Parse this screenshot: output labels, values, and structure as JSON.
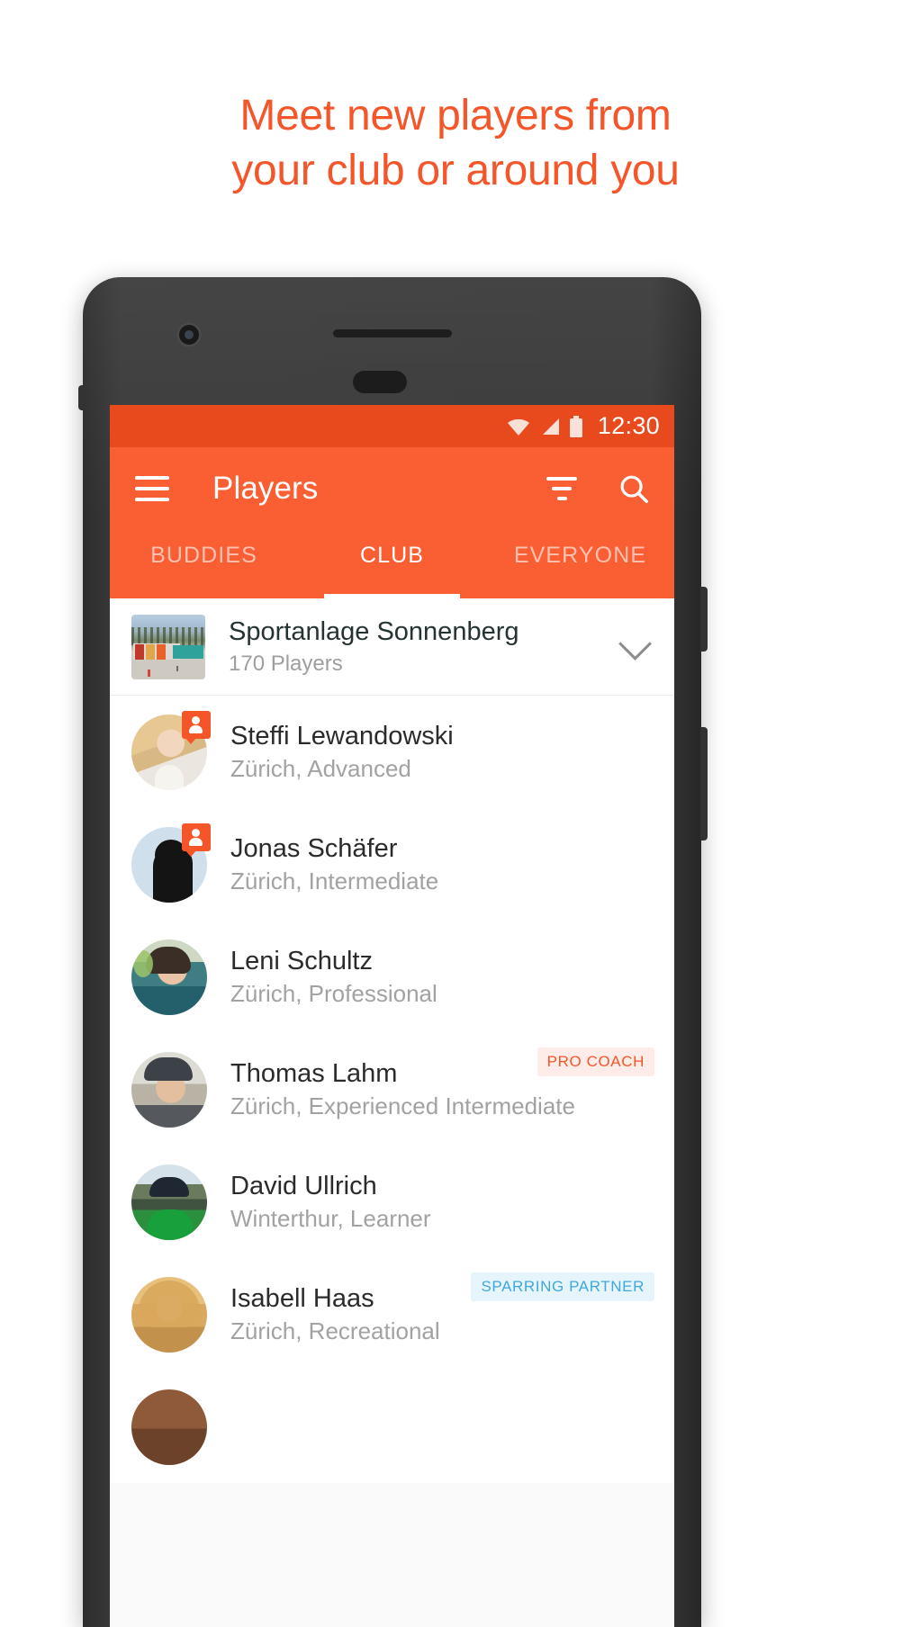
{
  "headline": {
    "line1": "Meet new players from",
    "line2": "your club or around you",
    "color": "#f4562a"
  },
  "phone": {
    "statusbar": {
      "clock": "12:30",
      "icons": [
        "wifi-icon",
        "signal-icon",
        "battery-icon"
      ],
      "background": "#e8491d"
    },
    "appbar": {
      "menu_icon": "hamburger-menu-icon",
      "title": "Players",
      "filter_icon": "filter-icon",
      "search_icon": "search-icon",
      "background": "#fa5e33"
    },
    "tabs": [
      {
        "label": "BUDDIES",
        "active": false
      },
      {
        "label": "CLUB",
        "active": true
      },
      {
        "label": "EVERYONE",
        "active": false
      }
    ],
    "club": {
      "name": "Sportanlage Sonnenberg",
      "members": "170 Players",
      "expand_icon": "chevron-down-icon",
      "thumbnail": "club-photo"
    },
    "players": [
      {
        "name": "Steffi Lewandowski",
        "detail": "Zürich, Advanced",
        "badge_icon": "person-badge-icon",
        "tag": ""
      },
      {
        "name": "Jonas Schäfer",
        "detail": "Zürich, Intermediate",
        "badge_icon": "person-badge-icon",
        "tag": ""
      },
      {
        "name": "Leni Schultz",
        "detail": "Zürich, Professional",
        "badge_icon": "",
        "tag": ""
      },
      {
        "name": "Thomas Lahm",
        "detail": "Zürich, Experienced Intermediate",
        "badge_icon": "",
        "tag": "PRO COACH",
        "tag_color": "#f4562a",
        "tag_background": "#fdece7"
      },
      {
        "name": "David Ullrich",
        "detail": "Winterthur, Learner",
        "badge_icon": "",
        "tag": ""
      },
      {
        "name": "Isabell Haas",
        "detail": "Zürich, Recreational",
        "badge_icon": "",
        "tag": "SPARRING PARTNER",
        "tag_color": "#3fa9dd",
        "tag_background": "#e6f4fb"
      }
    ]
  }
}
